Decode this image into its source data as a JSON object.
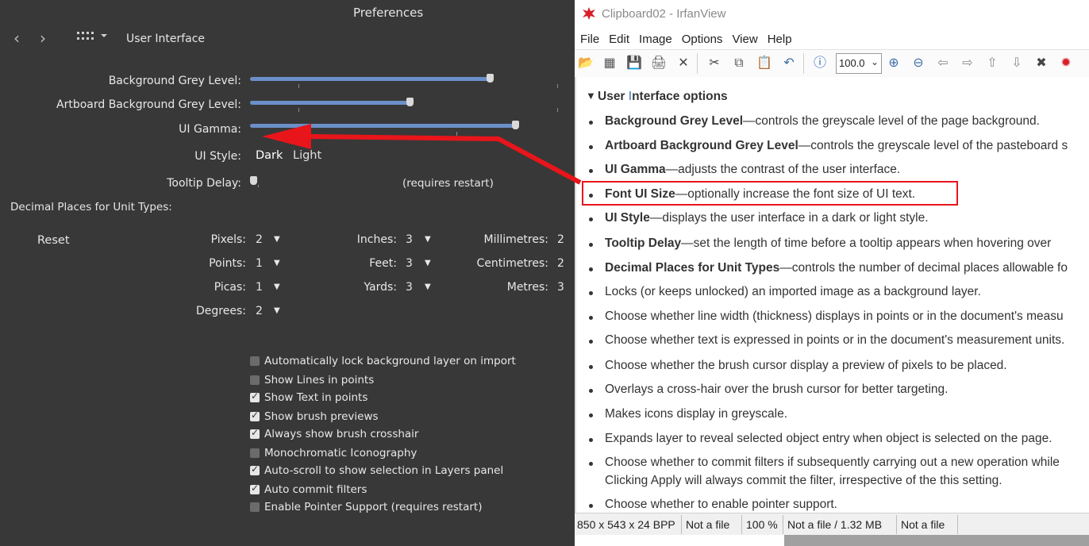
{
  "prefs": {
    "title": "Preferences",
    "section": "User Interface",
    "sliders": [
      {
        "label": "Background Grey Level:",
        "value": 0.87
      },
      {
        "label": "Artboard Background Grey Level:",
        "value": 0.53
      },
      {
        "label": "UI Gamma:",
        "value": 0.95
      }
    ],
    "ui_style": {
      "label": "UI Style:",
      "options": [
        "Dark",
        "Light"
      ],
      "selected": "Dark"
    },
    "tooltip": {
      "label": "Tooltip Delay:",
      "note": "(requires restart)",
      "value": 0.0
    },
    "decimal_title": "Decimal Places for Unit Types:",
    "reset_label": "Reset",
    "units": [
      {
        "label": "Pixels:",
        "value": "2"
      },
      {
        "label": "Points:",
        "value": "1"
      },
      {
        "label": "Picas:",
        "value": "1"
      },
      {
        "label": "Degrees:",
        "value": "2"
      },
      {
        "label": "Inches:",
        "value": "3"
      },
      {
        "label": "Feet:",
        "value": "3"
      },
      {
        "label": "Yards:",
        "value": "3"
      },
      {
        "label": "Millimetres:",
        "value": "2"
      },
      {
        "label": "Centimetres:",
        "value": "2"
      },
      {
        "label": "Metres:",
        "value": "3"
      }
    ],
    "checks": [
      {
        "label": "Automatically lock background layer on import",
        "checked": false
      },
      {
        "label": "Show Lines in points",
        "checked": false
      },
      {
        "label": "Show Text in points",
        "checked": true
      },
      {
        "label": "Show brush previews",
        "checked": true
      },
      {
        "label": "Always show brush crosshair",
        "checked": true
      },
      {
        "label": "Monochromatic Iconography",
        "checked": false
      },
      {
        "label": "Auto-scroll to show selection in Layers panel",
        "checked": true
      },
      {
        "label": "Auto commit filters",
        "checked": true
      },
      {
        "label": "Enable Pointer Support (requires restart)",
        "checked": false
      }
    ]
  },
  "irfan": {
    "title": "Clipboard02 - IrfanView",
    "menu": [
      "File",
      "Edit",
      "Image",
      "Options",
      "View",
      "Help"
    ],
    "zoom": "100.0",
    "heading_pre": "User ",
    "heading_cursor": "I",
    "heading_post": "nterface options",
    "items": [
      {
        "bold": "Background Grey Level",
        "text": "—controls the greyscale level of the page background."
      },
      {
        "bold": "Artboard Background Grey Level",
        "text": "—controls the greyscale level of the pasteboard s"
      },
      {
        "bold": "UI Gamma",
        "text": "—adjusts the contrast of the user interface."
      },
      {
        "bold": "Font UI Size",
        "text": "—optionally increase the font size of UI text."
      },
      {
        "bold": "UI Style",
        "text": "—displays the user interface in a dark or light style."
      },
      {
        "bold": "Tooltip Delay",
        "text": "—set the length of time before a tooltip appears when hovering over"
      },
      {
        "bold": "Decimal Places for Unit Types",
        "text": "—controls the number of decimal places allowable fo"
      },
      {
        "bold": "",
        "text": "Locks (or keeps unlocked) an imported image as a background layer."
      },
      {
        "bold": "",
        "text": "Choose whether line width (thickness) displays in points or in the document's measu"
      },
      {
        "bold": "",
        "text": "Choose whether text is expressed in points or in the document's measurement units."
      },
      {
        "bold": "",
        "text": "Choose whether the brush cursor display a preview of pixels to be placed."
      },
      {
        "bold": "",
        "text": "Overlays a cross-hair over the brush cursor for better targeting."
      },
      {
        "bold": "",
        "text": "Makes icons display in greyscale."
      },
      {
        "bold": "",
        "text": "Expands layer to reveal selected object entry when object is selected on the page."
      },
      {
        "bold": "",
        "text": "Choose whether to commit filters if subsequently carrying out a new operation while"
      },
      {
        "bold": "",
        "text": "Clicking Apply will always commit the filter, irrespective of the this setting."
      },
      {
        "bold": "",
        "text": "Choose whether to enable pointer support."
      }
    ],
    "status": [
      "850 x 543 x 24 BPP",
      "Not a file",
      "100 %",
      "Not a file / 1.32 MB",
      "Not a file"
    ]
  },
  "colors": {
    "accent": "#6b8fc8",
    "arrow": "#e8151b"
  }
}
